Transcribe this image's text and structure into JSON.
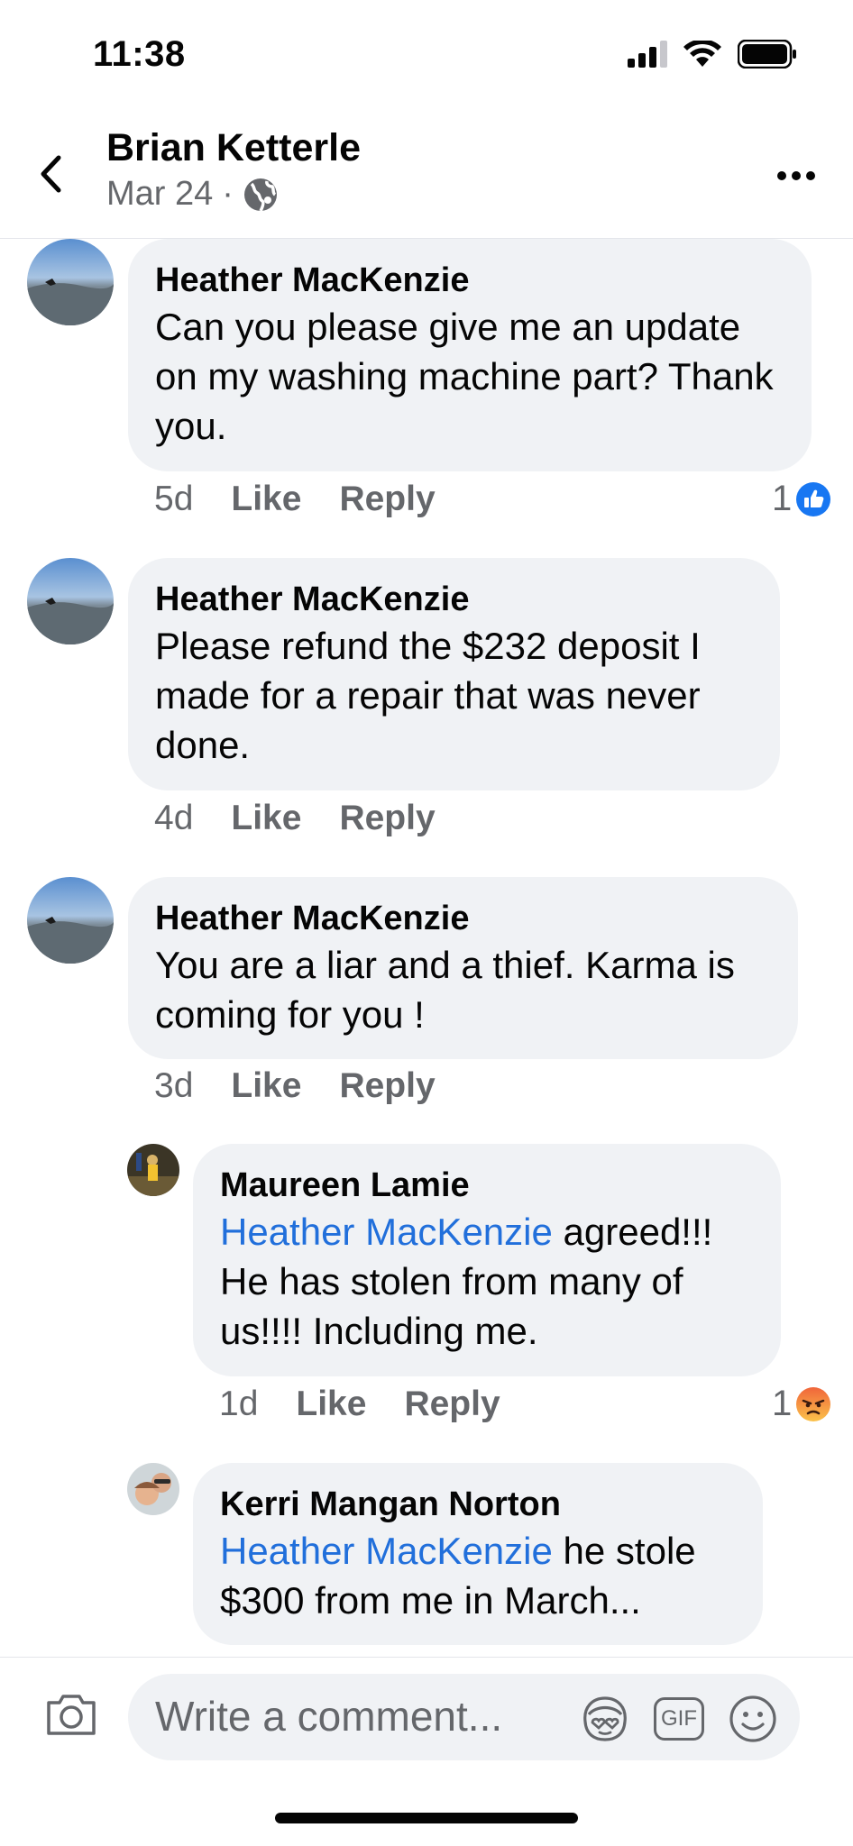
{
  "status_bar": {
    "time": "11:38"
  },
  "header": {
    "title": "Brian Ketterle",
    "date": "Mar 24",
    "separator": "·"
  },
  "comments": [
    {
      "author": "Heather MacKenzie",
      "mention": "",
      "text": "Can you please give me an update on my washing machine part? Thank you.",
      "time": "5d",
      "like": "Like",
      "reply": "Reply",
      "reaction_count": "1",
      "reaction_type": "like-reaction-icon"
    },
    {
      "author": "Heather MacKenzie",
      "mention": "",
      "text": "Please refund the $232 deposit I made for a repair that was never done.",
      "time": "4d",
      "like": "Like",
      "reply": "Reply"
    },
    {
      "author": "Heather MacKenzie",
      "mention": "",
      "text": "You are a liar and a thief. Karma is coming for you !",
      "time": "3d",
      "like": "Like",
      "reply": "Reply"
    },
    {
      "author": "Maureen Lamie",
      "mention": "Heather MacKenzie",
      "text": " agreed!!! He has stolen from many of us!!!!  Including me.",
      "time": "1d",
      "like": "Like",
      "reply": "Reply",
      "reaction_count": "1",
      "reaction_type": "angry-reaction-icon"
    },
    {
      "author": "Kerri Mangan Norton",
      "mention": "Heather MacKenzie",
      "text": " he stole $300 from me in March...",
      "time": "",
      "like": "",
      "reply": ""
    }
  ],
  "composer": {
    "placeholder": "Write a comment...",
    "gif_label": "GIF"
  },
  "colors": {
    "bubble": "#f0f2f5",
    "mention": "#216fdb",
    "like_blue": "#1877f2",
    "angry_orange": "#f0653a",
    "meta_gray": "#65676b"
  }
}
